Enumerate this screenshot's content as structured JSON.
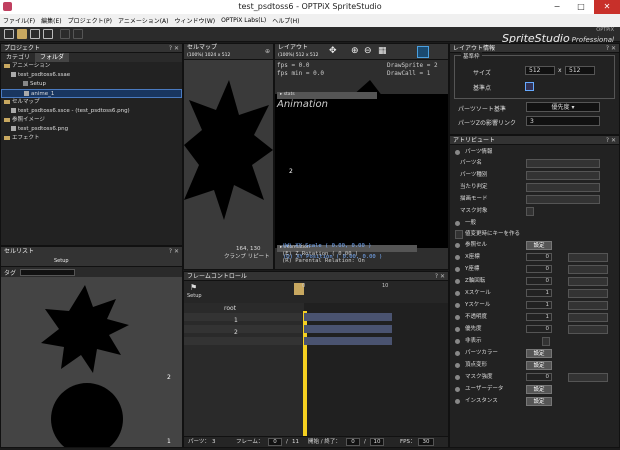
{
  "window": {
    "title": "test_psdtoss6 - OPTPiX SpriteStudio",
    "min": "−",
    "max": "□",
    "close": "✕"
  },
  "menu": [
    "ファイル(F)",
    "編集(E)",
    "プロジェクト(P)",
    "アニメーション(A)",
    "ウィンドウ(W)",
    "OPTPiX Labs(L)",
    "ヘルプ(H)"
  ],
  "logo": {
    "small": "OPTPiX",
    "big": "SpriteStudio",
    "edition": "Professional"
  },
  "project": {
    "title": "プロジェクト",
    "tabs": [
      "カテゴリ",
      "フォルダ"
    ],
    "tree": [
      "アニメーション",
      "test_psdtoss6.ssae",
      "Setup",
      "anime_1",
      "セルマップ",
      "test_psdtoss6.ssce - (test_psdtoss6.png)",
      "参照イメージ",
      "test_psdtoss6.png",
      "エフェクト"
    ]
  },
  "celllist": {
    "title": "セルリスト",
    "setup_label": "Setup",
    "tag_label": "タグ",
    "num2": "2",
    "num1": "1"
  },
  "cellmap": {
    "title": "セルマップ",
    "size": "(100%) 1024 x 512",
    "coord": "164, 130",
    "clamp": "クランプ",
    "rep": "リピート"
  },
  "layout": {
    "title": "レイアウト",
    "size": "(100%) 512 x 512",
    "fps": "fps = 0.0",
    "fpsmin": "fps min = 0.0",
    "drawsprite": "DrawSprite = 2",
    "drawcall": "DrawCall = 1",
    "stats_tag": "stats",
    "anim_title": "Animation",
    "label2": "2",
    "info_tag": "information",
    "info": [
      "(Q) XY Position ( 0.00, 0.00 )",
      "(W) XY Scale ( 0.00, 0.00 )",
      "(E) Z Rotation ( 0.00 )",
      "(R) Parental Relation: On"
    ]
  },
  "frame": {
    "title": "フレームコントロール",
    "setup_label": "Setup",
    "root": "root",
    "p1": "1",
    "p2": "2",
    "tick0": "0",
    "tick10": "10",
    "status": {
      "parts_label": "パーツ：",
      "parts": "3",
      "frame_label": "フレーム：",
      "frame": "0",
      "total": "11",
      "range_label": "開始 / 終了：",
      "start": "0",
      "end": "10",
      "fps_label": "FPS：",
      "fps": "30"
    }
  },
  "layoutinfo": {
    "title": "レイアウト情報",
    "group": "基準枠",
    "size_label": "サイズ",
    "w": "512",
    "h": "512",
    "base_label": "基準点",
    "sort_label": "パーツソート基準",
    "sort_value": "優先度",
    "depth_label": "パーツZの影響リンク",
    "depth_value": "3"
  },
  "attr": {
    "title": "アトリビュート",
    "section": "パーツ情報",
    "part_name": "パーツ名",
    "part_kind": "パーツ種別",
    "hit": "当たり判定",
    "draw": "描画モード",
    "mask": "マスク対象",
    "general": "一般",
    "keep": "値変更時にキーを作る",
    "rows": [
      {
        "label": "参照セル",
        "ctl": "設定"
      },
      {
        "label": "X座標",
        "val": "0"
      },
      {
        "label": "Y座標",
        "val": "0"
      },
      {
        "label": "Z軸回転",
        "val": "0"
      },
      {
        "label": "Xスケール",
        "val": "1"
      },
      {
        "label": "Yスケール",
        "val": "1"
      },
      {
        "label": "不透明度",
        "val": "1"
      },
      {
        "label": "優先度",
        "val": "0"
      },
      {
        "label": "非表示",
        "val": ""
      },
      {
        "label": "パーツカラー",
        "ctl": "設定"
      },
      {
        "label": "頂点変形",
        "ctl": "設定"
      },
      {
        "label": "マスク強度",
        "val": "0"
      },
      {
        "label": "ユーザーデータ",
        "ctl": "設定"
      },
      {
        "label": "インスタンス",
        "ctl": "設定"
      }
    ]
  },
  "colors": {
    "accent": "#f5d020",
    "select": "#193660",
    "bg": "#1b1b1b"
  }
}
